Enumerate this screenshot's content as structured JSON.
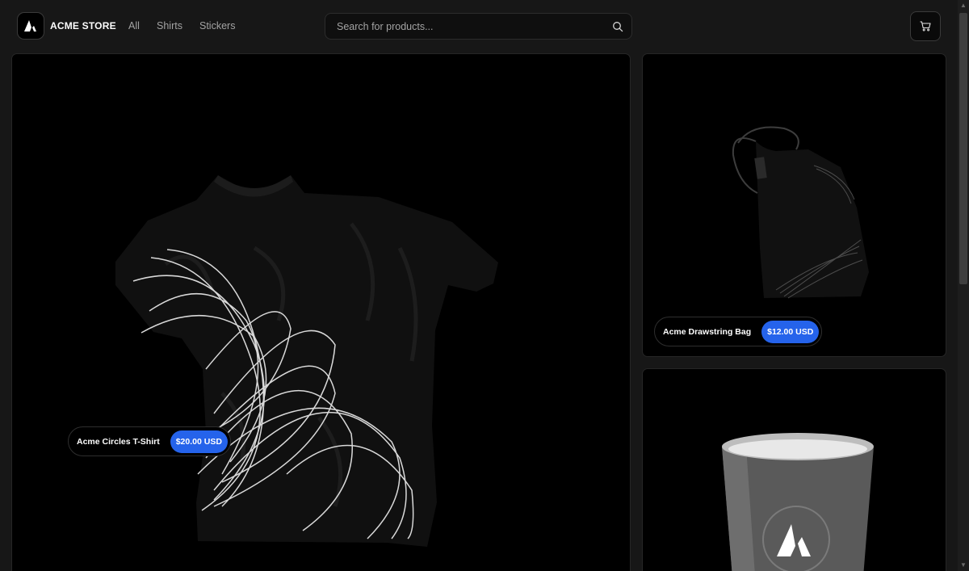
{
  "brand": {
    "name": "ACME STORE"
  },
  "nav": {
    "items": [
      {
        "label": "All"
      },
      {
        "label": "Shirts"
      },
      {
        "label": "Stickers"
      }
    ]
  },
  "search": {
    "placeholder": "Search for products..."
  },
  "products": {
    "main": {
      "name": "Acme Circles T-Shirt",
      "price": "$20.00 USD"
    },
    "bag": {
      "name": "Acme Drawstring Bag",
      "price": "$12.00 USD"
    }
  },
  "colors": {
    "accent": "#2563eb",
    "background": "#171717",
    "tile": "#000000"
  },
  "icons": {
    "logo": "acme-logo-icon",
    "search": "search-icon",
    "cart": "cart-icon"
  }
}
